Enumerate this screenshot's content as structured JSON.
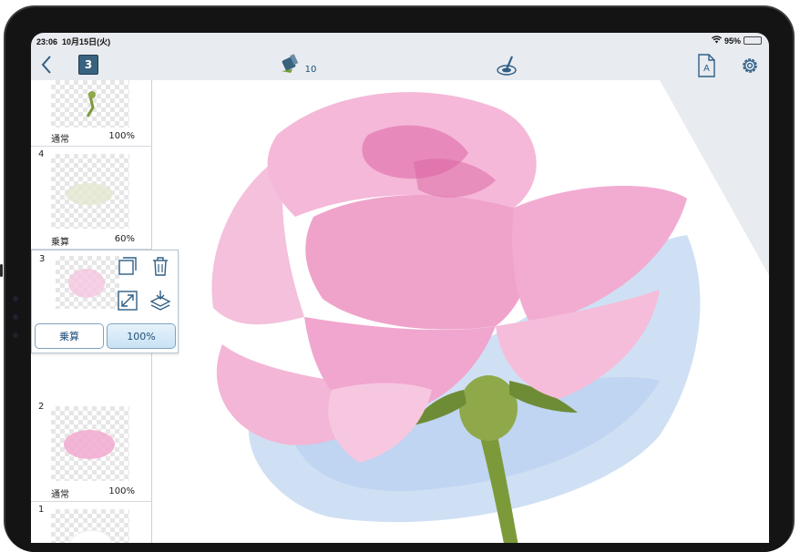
{
  "status_bar": {
    "time": "23:06",
    "date": "10月15日(火)",
    "battery": "95%",
    "battery_level": 0.95
  },
  "toolbar": {
    "back_icon": "chevron-left-icon",
    "current_layer": "3",
    "brush_size": "10",
    "brush_icon": "brush-icon",
    "smudge_icon": "eraser-smudge-icon",
    "export_icon": "document-a-icon",
    "settings_icon": "gear-icon"
  },
  "layers": [
    {
      "number": "",
      "mode": "通常",
      "opacity": "100%"
    },
    {
      "number": "4",
      "mode": "乗算",
      "opacity": "60%"
    },
    {
      "number": "3",
      "mode": "乗算",
      "opacity": "100%"
    },
    {
      "number": "2",
      "mode": "通常",
      "opacity": "100%"
    },
    {
      "number": "1",
      "mode": "",
      "opacity": ""
    }
  ],
  "selected_layer_actions": {
    "mode_button": "乗算",
    "opacity_button": "100%",
    "icons": [
      "duplicate-icon",
      "trash-icon",
      "resize-icon",
      "merge-down-icon"
    ]
  },
  "colors": {
    "accent": "#2f5f86",
    "petal": "#f2a9cf",
    "stem": "#7c9a3a",
    "shadow": "#b9d2ef"
  }
}
